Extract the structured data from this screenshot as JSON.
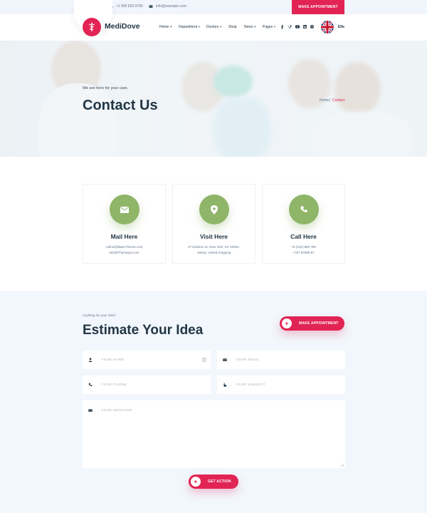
{
  "topbar": {
    "phone": "+1 800 833 9780",
    "email": "info@example.com",
    "appointment_label": "MAKE APPOINTMENT"
  },
  "header": {
    "brand": "MediDove",
    "nav": [
      "Home +",
      "Department +",
      "Doctors +",
      "Shop",
      "News +",
      "Pages +"
    ],
    "social_icons": [
      "facebook-icon",
      "vimeo-icon",
      "youtube-icon",
      "linkedin-icon",
      "pinterest-icon"
    ],
    "language": "EN"
  },
  "hero": {
    "subtitle": "We are here for your care.",
    "title": "Contact Us",
    "breadcrumb": [
      "Home",
      "|",
      "Contact"
    ]
  },
  "cards": [
    {
      "icon": "envelope-icon",
      "title": "Mail Here",
      "lines": [
        "Admin@BasicTheme.com",
        "Info@Themepur.com"
      ]
    },
    {
      "icon": "map-marker-icon",
      "title": "Visit Here",
      "lines": [
        "27 Division St, New York, NY 10002,",
        "Jakina, United Kingjung"
      ]
    },
    {
      "icon": "phone-icon",
      "title": "Call Here",
      "lines": [
        "+8 (123) 985 789",
        "+787 87889 87"
      ]
    }
  ],
  "form": {
    "pretitle": "Anything On your Mind",
    "title": "Estimate Your Idea",
    "appointment_label": "MAKE APPOINTMENT",
    "fields": {
      "name": "YOUR NAME",
      "email": "YOUR EMAIL",
      "phone": "YOUR PHONE",
      "subject": "YOUR SUBJECT",
      "message": "YOUR MESSAGE"
    },
    "submit_label": "GET ACTION"
  },
  "colors": {
    "accent": "#e12454",
    "icon_green": "#8fb569",
    "dark": "#223645",
    "muted": "#647589",
    "section_bg": "#f2f7fd"
  }
}
